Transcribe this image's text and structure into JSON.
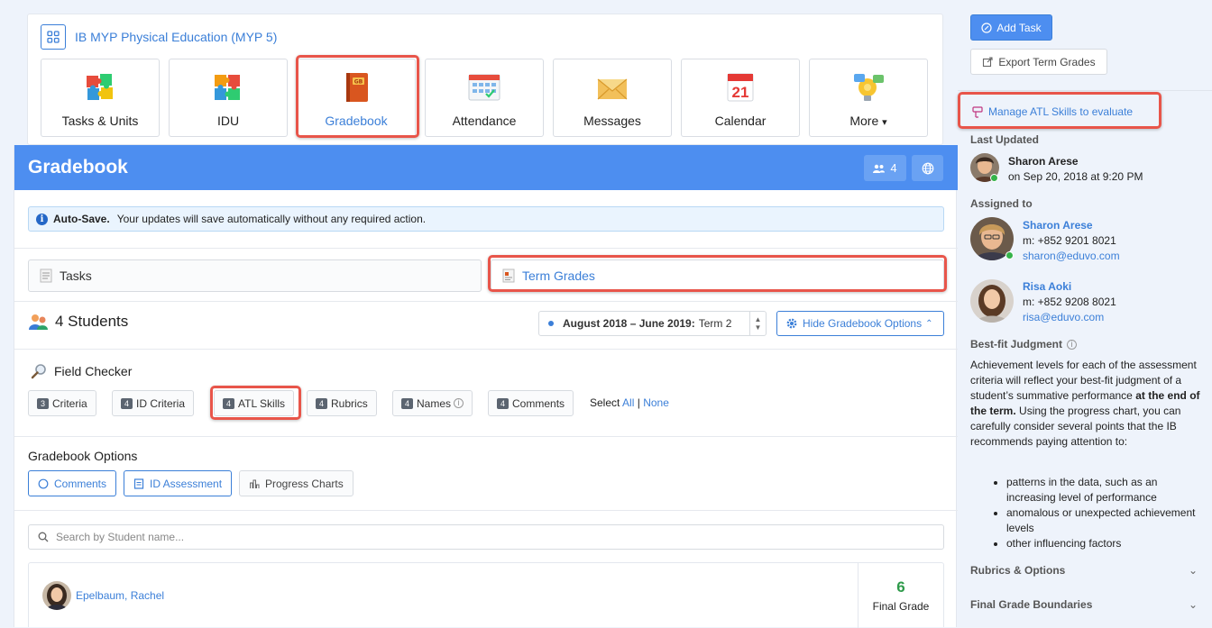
{
  "class": {
    "title": "IB MYP Physical Education (MYP 5)",
    "tiles": [
      {
        "label": "Tasks & Units",
        "icon": "puzzle-icon"
      },
      {
        "label": "IDU",
        "icon": "puzzle-icon"
      },
      {
        "label": "Gradebook",
        "icon": "gradebook-book-icon",
        "active": true
      },
      {
        "label": "Attendance",
        "icon": "attendance-chart-icon"
      },
      {
        "label": "Messages",
        "icon": "envelope-icon"
      },
      {
        "label": "Calendar",
        "icon": "calendar-icon",
        "day": "21"
      },
      {
        "label": "More",
        "icon": "lightbulb-chat-icon",
        "caret": "▾"
      }
    ]
  },
  "gradebook": {
    "title": "Gradebook",
    "member_count": "4",
    "autosave": {
      "bold": "Auto-Save.",
      "text": "Your updates will save automatically without any required action."
    },
    "tabs": {
      "tasks": "Tasks",
      "term_grades": "Term Grades"
    },
    "students_title": "4 Students",
    "term": {
      "range": "August 2018 – June 2019:",
      "term": "Term 2"
    },
    "hide_options": "Hide Gradebook Options",
    "field_checker": {
      "label": "Field Checker",
      "items": [
        {
          "count": "3",
          "label": "Criteria"
        },
        {
          "count": "4",
          "label": "ID Criteria"
        },
        {
          "count": "4",
          "label": "ATL Skills"
        },
        {
          "count": "4",
          "label": "Rubrics"
        },
        {
          "count": "4",
          "label": "Names"
        },
        {
          "count": "4",
          "label": "Comments"
        }
      ],
      "select_label": "Select",
      "all": "All",
      "sep": "|",
      "none": "None"
    },
    "options": {
      "label": "Gradebook Options",
      "buttons": [
        "Comments",
        "ID Assessment",
        "Progress Charts"
      ]
    },
    "search": {
      "placeholder": "Search by Student name..."
    },
    "student": {
      "name": "Epelbaum, Rachel",
      "grade": "6",
      "grade_label": "Final Grade"
    }
  },
  "sidebar": {
    "add_task": "Add Task",
    "export": "Export Term Grades",
    "manage_atl": "Manage ATL Skills to evaluate",
    "last_updated": {
      "heading": "Last Updated",
      "name": "Sharon Arese",
      "date": "on Sep 20, 2018 at 9:20 PM"
    },
    "assigned": {
      "heading": "Assigned to",
      "people": [
        {
          "name": "Sharon Arese",
          "phone": "m: +852 9201 8021",
          "email": "sharon@eduvo.com"
        },
        {
          "name": "Risa Aoki",
          "phone": "m: +852 9208 8021",
          "email": "risa@eduvo.com"
        }
      ]
    },
    "bestfit": {
      "heading": "Best-fit Judgment",
      "text_1": "Achievement levels for each of the assessment criteria will reflect your best-fit judgment of a student’s summative performance ",
      "text_bold": "at the end of the term.",
      "text_2": " Using the progress chart, you can carefully consider several points that the IB recommends paying attention to:",
      "points": [
        "patterns in the data, such as an increasing level of performance",
        "anomalous or unexpected achievement levels",
        "other influencing factors"
      ]
    },
    "rubrics": "Rubrics & Options",
    "boundaries": "Final Grade Boundaries"
  },
  "colors": {
    "accent": "#4d8ef0",
    "highlight": "#e8554a",
    "link": "#3b7fd8",
    "grade": "#2e9a4a"
  }
}
